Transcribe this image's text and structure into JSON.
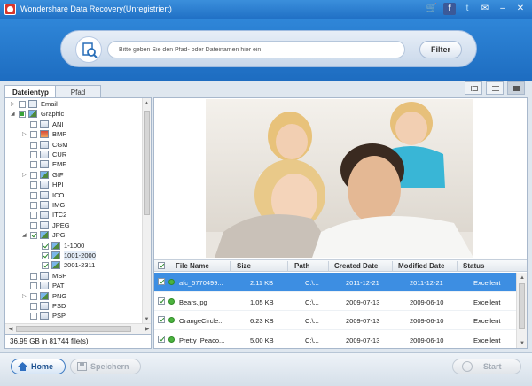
{
  "title": "Wondershare Data Recovery(Unregistriert)",
  "search": {
    "placeholder": "Bitte geben Sie den Pfad- oder Dateinamen hier ein",
    "filter_label": "Filter"
  },
  "tabs": [
    {
      "label": "Dateientyp",
      "active": true
    },
    {
      "label": "Pfad",
      "active": false
    }
  ],
  "tree": [
    {
      "label": "Email",
      "level": 0,
      "exp": "+",
      "check": "off",
      "icon": "mail"
    },
    {
      "label": "Graphic",
      "level": 0,
      "exp": "-",
      "check": "part",
      "icon": "pic"
    },
    {
      "label": "ANI",
      "level": 1,
      "exp": "",
      "check": "off",
      "icon": "file"
    },
    {
      "label": "BMP",
      "level": 1,
      "exp": "+",
      "check": "off",
      "icon": "red"
    },
    {
      "label": "CGM",
      "level": 1,
      "exp": "",
      "check": "off",
      "icon": "file"
    },
    {
      "label": "CUR",
      "level": 1,
      "exp": "",
      "check": "off",
      "icon": "file"
    },
    {
      "label": "EMF",
      "level": 1,
      "exp": "",
      "check": "off",
      "icon": "file"
    },
    {
      "label": "GIF",
      "level": 1,
      "exp": "+",
      "check": "off",
      "icon": "pic"
    },
    {
      "label": "HPI",
      "level": 1,
      "exp": "",
      "check": "off",
      "icon": "file"
    },
    {
      "label": "ICO",
      "level": 1,
      "exp": "",
      "check": "off",
      "icon": "file"
    },
    {
      "label": "IMG",
      "level": 1,
      "exp": "",
      "check": "off",
      "icon": "file"
    },
    {
      "label": "ITC2",
      "level": 1,
      "exp": "",
      "check": "off",
      "icon": "file"
    },
    {
      "label": "JPEG",
      "level": 1,
      "exp": "",
      "check": "off",
      "icon": "file"
    },
    {
      "label": "JPG",
      "level": 1,
      "exp": "-",
      "check": "on",
      "icon": "pic"
    },
    {
      "label": "1-1000",
      "level": 2,
      "exp": "",
      "check": "on",
      "icon": "pic"
    },
    {
      "label": "1001-2000",
      "level": 2,
      "exp": "",
      "check": "on",
      "icon": "pic",
      "selected": true
    },
    {
      "label": "2001-2311",
      "level": 2,
      "exp": "",
      "check": "on",
      "icon": "pic"
    },
    {
      "label": "MSP",
      "level": 1,
      "exp": "",
      "check": "off",
      "icon": "file"
    },
    {
      "label": "PAT",
      "level": 1,
      "exp": "",
      "check": "off",
      "icon": "file"
    },
    {
      "label": "PNG",
      "level": 1,
      "exp": "+",
      "check": "off",
      "icon": "pic"
    },
    {
      "label": "PSD",
      "level": 1,
      "exp": "",
      "check": "off",
      "icon": "file"
    },
    {
      "label": "PSP",
      "level": 1,
      "exp": "",
      "check": "off",
      "icon": "file"
    }
  ],
  "status_left": "36.95 GB in 81744 file(s)",
  "columns": [
    "File Name",
    "Size",
    "Path",
    "Created Date",
    "Modified Date",
    "Status"
  ],
  "files": [
    {
      "name": "afc_5770499...",
      "size": "2.11 KB",
      "path": "C:\\...",
      "created": "2011-12-21",
      "modified": "2011-12-21",
      "status": "Excellent",
      "selected": true
    },
    {
      "name": "Bears.jpg",
      "size": "1.05 KB",
      "path": "C:\\...",
      "created": "2009-07-13",
      "modified": "2009-06-10",
      "status": "Excellent"
    },
    {
      "name": "OrangeCircle...",
      "size": "6.23 KB",
      "path": "C:\\...",
      "created": "2009-07-13",
      "modified": "2009-06-10",
      "status": "Excellent"
    },
    {
      "name": "Pretty_Peaco...",
      "size": "5.00 KB",
      "path": "C:\\...",
      "created": "2009-07-13",
      "modified": "2009-06-10",
      "status": "Excellent"
    }
  ],
  "buttons": {
    "home": "Home",
    "save": "Speichern",
    "start": "Start"
  },
  "colors": {
    "accent": "#1f6fc4",
    "selection": "#3d8ee2",
    "ok": "#4cb33f"
  }
}
